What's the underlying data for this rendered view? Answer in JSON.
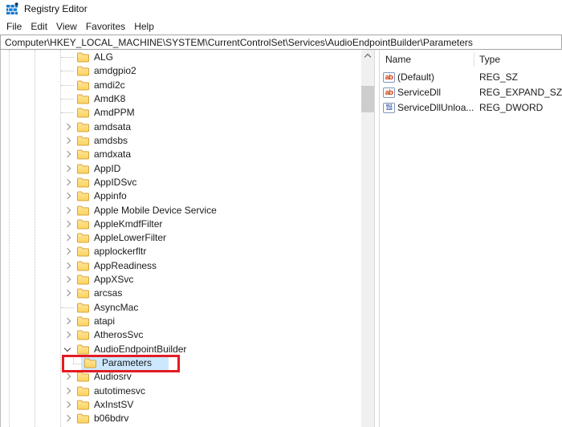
{
  "window": {
    "title": "Registry Editor"
  },
  "menu": {
    "items": [
      "File",
      "Edit",
      "View",
      "Favorites",
      "Help"
    ]
  },
  "address": {
    "path": "Computer\\HKEY_LOCAL_MACHINE\\SYSTEM\\CurrentControlSet\\Services\\AudioEndpointBuilder\\Parameters"
  },
  "tree": {
    "items": [
      {
        "label": "ALG",
        "level": 0,
        "state": "none"
      },
      {
        "label": "amdgpio2",
        "level": 0,
        "state": "none"
      },
      {
        "label": "amdi2c",
        "level": 0,
        "state": "none"
      },
      {
        "label": "AmdK8",
        "level": 0,
        "state": "none"
      },
      {
        "label": "AmdPPM",
        "level": 0,
        "state": "none"
      },
      {
        "label": "amdsata",
        "level": 0,
        "state": "collapsed"
      },
      {
        "label": "amdsbs",
        "level": 0,
        "state": "collapsed"
      },
      {
        "label": "amdxata",
        "level": 0,
        "state": "collapsed"
      },
      {
        "label": "AppID",
        "level": 0,
        "state": "collapsed"
      },
      {
        "label": "AppIDSvc",
        "level": 0,
        "state": "collapsed"
      },
      {
        "label": "Appinfo",
        "level": 0,
        "state": "collapsed"
      },
      {
        "label": "Apple Mobile Device Service",
        "level": 0,
        "state": "collapsed"
      },
      {
        "label": "AppleKmdfFilter",
        "level": 0,
        "state": "collapsed"
      },
      {
        "label": "AppleLowerFilter",
        "level": 0,
        "state": "collapsed"
      },
      {
        "label": "applockerfltr",
        "level": 0,
        "state": "collapsed"
      },
      {
        "label": "AppReadiness",
        "level": 0,
        "state": "collapsed"
      },
      {
        "label": "AppXSvc",
        "level": 0,
        "state": "collapsed"
      },
      {
        "label": "arcsas",
        "level": 0,
        "state": "collapsed"
      },
      {
        "label": "AsyncMac",
        "level": 0,
        "state": "none"
      },
      {
        "label": "atapi",
        "level": 0,
        "state": "collapsed"
      },
      {
        "label": "AtherosSvc",
        "level": 0,
        "state": "collapsed"
      },
      {
        "label": "AudioEndpointBuilder",
        "level": 0,
        "state": "expanded"
      },
      {
        "label": "Parameters",
        "level": 1,
        "state": "none",
        "selected": true,
        "red_box": true
      },
      {
        "label": "Audiosrv",
        "level": 0,
        "state": "collapsed"
      },
      {
        "label": "autotimesvc",
        "level": 0,
        "state": "collapsed"
      },
      {
        "label": "AxInstSV",
        "level": 0,
        "state": "collapsed"
      },
      {
        "label": "b06bdrv",
        "level": 0,
        "state": "collapsed"
      }
    ]
  },
  "values": {
    "columns": [
      "Name",
      "Type"
    ],
    "rows": [
      {
        "name": "(Default)",
        "type": "REG_SZ",
        "icon": "string-value-icon"
      },
      {
        "name": "ServiceDll",
        "type": "REG_EXPAND_SZ",
        "icon": "string-value-icon"
      },
      {
        "name": "ServiceDllUnloa...",
        "type": "REG_DWORD",
        "icon": "dword-value-icon"
      }
    ]
  },
  "icons": {
    "string_glyph": "ab",
    "dword_glyph_line1": "011",
    "dword_glyph_line2": "110"
  },
  "colors": {
    "selection": "#cce8ff",
    "annotation_red": "#e31b23",
    "folder_fill": "#fcd25e",
    "folder_stroke": "#d9a43c",
    "string_icon_text": "#cc3300",
    "dword_icon_text": "#2b4ea8"
  }
}
